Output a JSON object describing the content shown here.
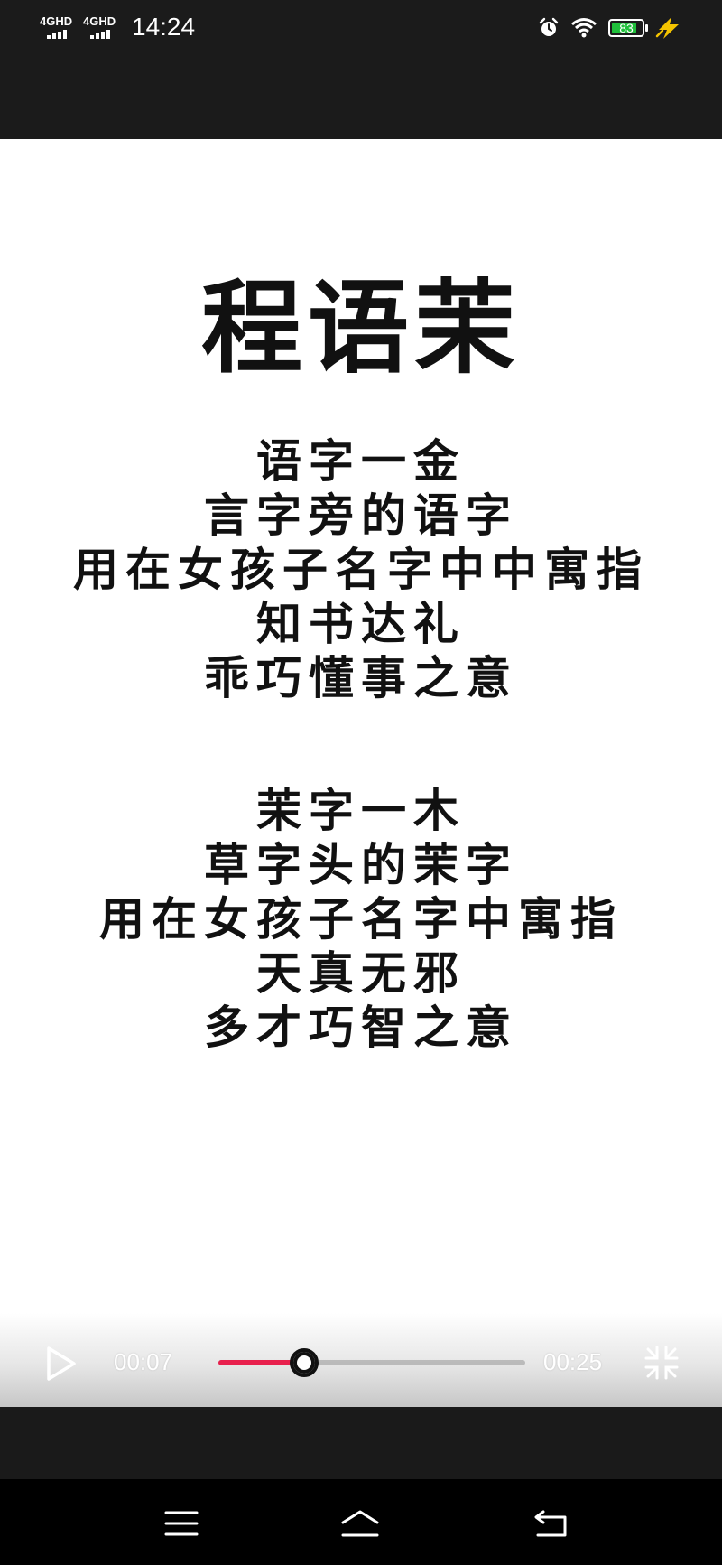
{
  "status_bar": {
    "network_1": "4GHD",
    "network_2": "4GHD",
    "time": "14:24",
    "battery_level": "83",
    "battery_fraction": 0.83,
    "icons": [
      "alarm-icon",
      "wifi-icon",
      "battery-icon",
      "charging-bolt-icon"
    ]
  },
  "video": {
    "title": "程语茉",
    "paragraph_1": [
      "语字一金",
      "言字旁的语字",
      "用在女孩子名字中中寓指",
      "知书达礼",
      "乖巧懂事之意"
    ],
    "paragraph_2": [
      "茉字一木",
      "草字头的茉字",
      "用在女孩子名字中寓指",
      "天真无邪",
      "多才巧智之意"
    ]
  },
  "player": {
    "current_time": "00:07",
    "total_time": "00:25",
    "progress": 0.28,
    "progress_color": "#e8204d",
    "icons": [
      "play-icon",
      "fullscreen-exit-icon"
    ]
  },
  "nav_bar": {
    "icons": [
      "menu-icon",
      "home-icon",
      "back-icon"
    ]
  }
}
